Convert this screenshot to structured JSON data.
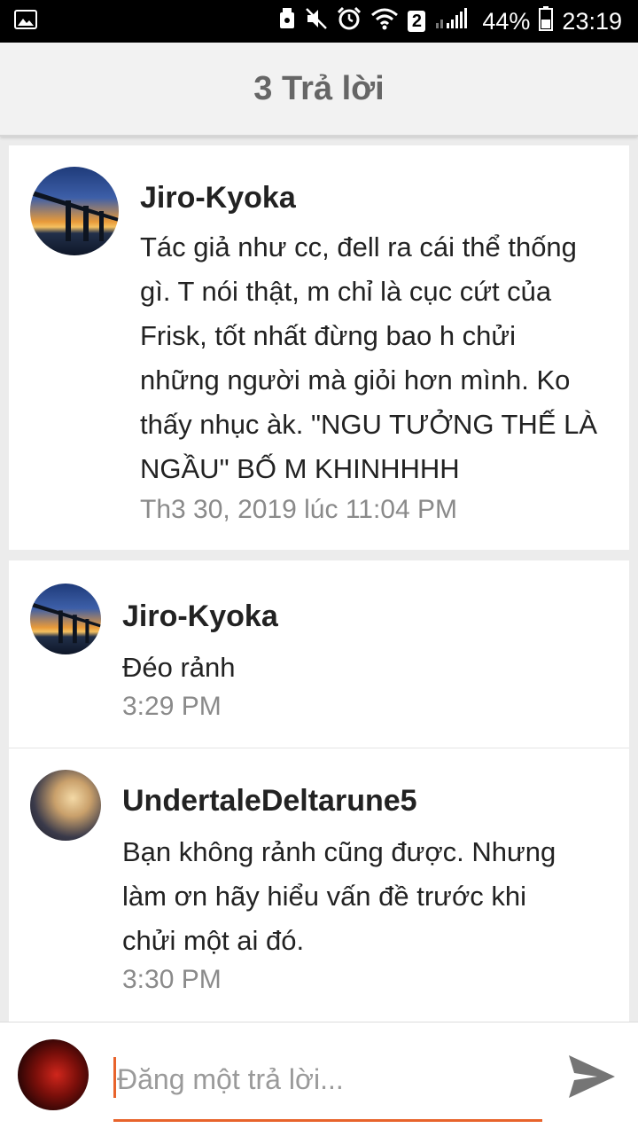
{
  "status_bar": {
    "badge": "2",
    "battery": "44%",
    "time": "23:19",
    "icons": [
      "image-icon",
      "android-icon",
      "mute-icon",
      "alarm-icon",
      "wifi-icon",
      "signal-icon",
      "battery-icon"
    ]
  },
  "header": {
    "title": "3 Trả lời"
  },
  "main_comment": {
    "user": "Jiro-Kyoka",
    "text": "Tác giả như cc, đell ra cái thể thống gì. T nói thật, m chỉ là cục cứt của Frisk, tốt nhất đừng bao h chửi những người mà giỏi hơn mình. Ko thấy nhục àk. \"NGU TƯỞNG THẾ LÀ NGẦU\" BỐ M KHINHHHH",
    "lines": [
      "Tác giả như cc, đell ra cái thể thống",
      "gì. T nói thật, m chỉ là cục cứt của",
      "Frisk, tốt nhất đừng bao h chửi",
      "những người mà giỏi hơn mình. Ko",
      "thấy nhục àk. \"NGU TƯỞNG THẾ LÀ",
      "NGẦU\" BỐ M KHINHHHH"
    ],
    "time": "Th3 30, 2019 lúc 11:04 PM"
  },
  "replies": [
    {
      "user": "Jiro-Kyoka",
      "lines": [
        "Đéo rảnh"
      ],
      "time": "3:29 PM"
    },
    {
      "user": "UndertaleDeltarune5",
      "lines": [
        "Bạn không rảnh cũng được. Nhưng",
        "làm ơn hãy hiểu vấn đề trước khi",
        "chửi một ai đó."
      ],
      "time": "3:30 PM"
    }
  ],
  "compose": {
    "placeholder": "Đăng một trả lời...",
    "value": ""
  },
  "colors": {
    "accent": "#e8632b",
    "header_bg": "#f2f2f2",
    "page_bg": "#ececec",
    "time_text": "#8a8a8a"
  }
}
